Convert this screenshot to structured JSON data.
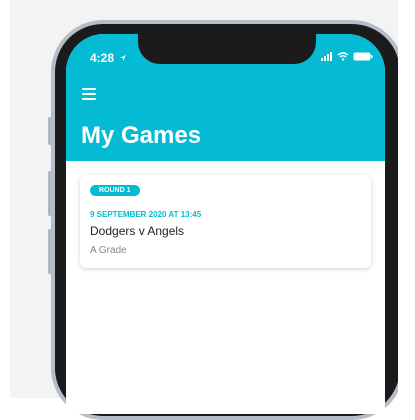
{
  "status": {
    "time": "4:28"
  },
  "header": {
    "title": "My Games"
  },
  "games": [
    {
      "round": "ROUND 1",
      "datetime": "9 SEPTEMBER 2020 AT 13:45",
      "teams": "Dodgers v Angels",
      "grade": "A Grade"
    }
  ],
  "colors": {
    "accent": "#05bbd3",
    "frame": "#b4bec9",
    "bezel": "#1b1b1b"
  },
  "icons": [
    "menu-icon",
    "location-arrow-icon",
    "cellular-signal-icon",
    "wifi-icon",
    "battery-icon"
  ]
}
